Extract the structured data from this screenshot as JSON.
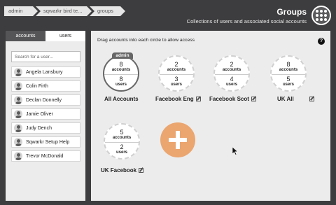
{
  "breadcrumb": [
    "admin",
    "sqwarkr bird te...",
    "groups"
  ],
  "header": {
    "title": "Groups",
    "subtitle": "Collections of users and associated social accounts"
  },
  "sidebar": {
    "tabs": [
      {
        "label": "accounts",
        "active": true
      },
      {
        "label": "users",
        "active": false
      }
    ],
    "search_placeholder": "Search for a user...",
    "users": [
      "Angela Lansbury",
      "Colin Firth",
      "Declan Donnelly",
      "Jamie Oliver",
      "Judy Dench",
      "Sqwarkr Setup Help",
      "Trevor McDonald"
    ]
  },
  "main": {
    "instruction": "Drag accounts into each circle to allow access",
    "help_label": "?",
    "admin_badge": "admin",
    "groups": [
      {
        "name": "All Accounts",
        "accounts": "8",
        "users": "8",
        "accounts_label": "accounts",
        "users_label": "users",
        "editable": false,
        "admin": true
      },
      {
        "name": "Facebook Eng",
        "accounts": "2",
        "users": "3",
        "accounts_label": "accounts",
        "users_label": "users",
        "editable": true
      },
      {
        "name": "Facebook Scot",
        "accounts": "2",
        "users": "4",
        "accounts_label": "accounts",
        "users_label": "users",
        "editable": true
      },
      {
        "name": "UK All",
        "accounts": "8",
        "users": "5",
        "accounts_label": "accounts",
        "users_label": "users",
        "editable": true
      },
      {
        "name": "UK Facebook",
        "accounts": "5",
        "users": "2",
        "accounts_label": "accounts",
        "users_label": "users",
        "editable": true
      }
    ]
  },
  "colors": {
    "background": "#3d3d3f",
    "panel": "#ececec",
    "accent": "#eba56f"
  }
}
